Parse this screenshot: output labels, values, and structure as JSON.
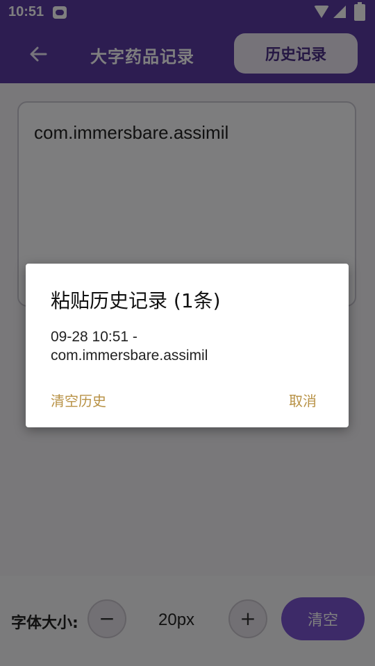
{
  "status_bar": {
    "time": "10:51"
  },
  "app_bar": {
    "back_icon": "arrow-left-icon",
    "title": "大字药品记录",
    "history_label": "历史记录"
  },
  "editor": {
    "text": "com.immersbare.assimil"
  },
  "bottom": {
    "font_size_label": "字体大小:",
    "minus_label": "−",
    "font_size_value": "20px",
    "plus_label": "+",
    "clear_label": "清空"
  },
  "dialog": {
    "title": "粘贴历史记录 (1条)",
    "items": [
      {
        "time": "09-28 10:51 -",
        "text": "com.immersbare.assimil"
      }
    ],
    "clear_history_label": "清空历史",
    "cancel_label": "取消"
  },
  "colors": {
    "primary": "#5a3aa3",
    "accent_text": "#b89246",
    "clear_button": "#7a55d1"
  }
}
